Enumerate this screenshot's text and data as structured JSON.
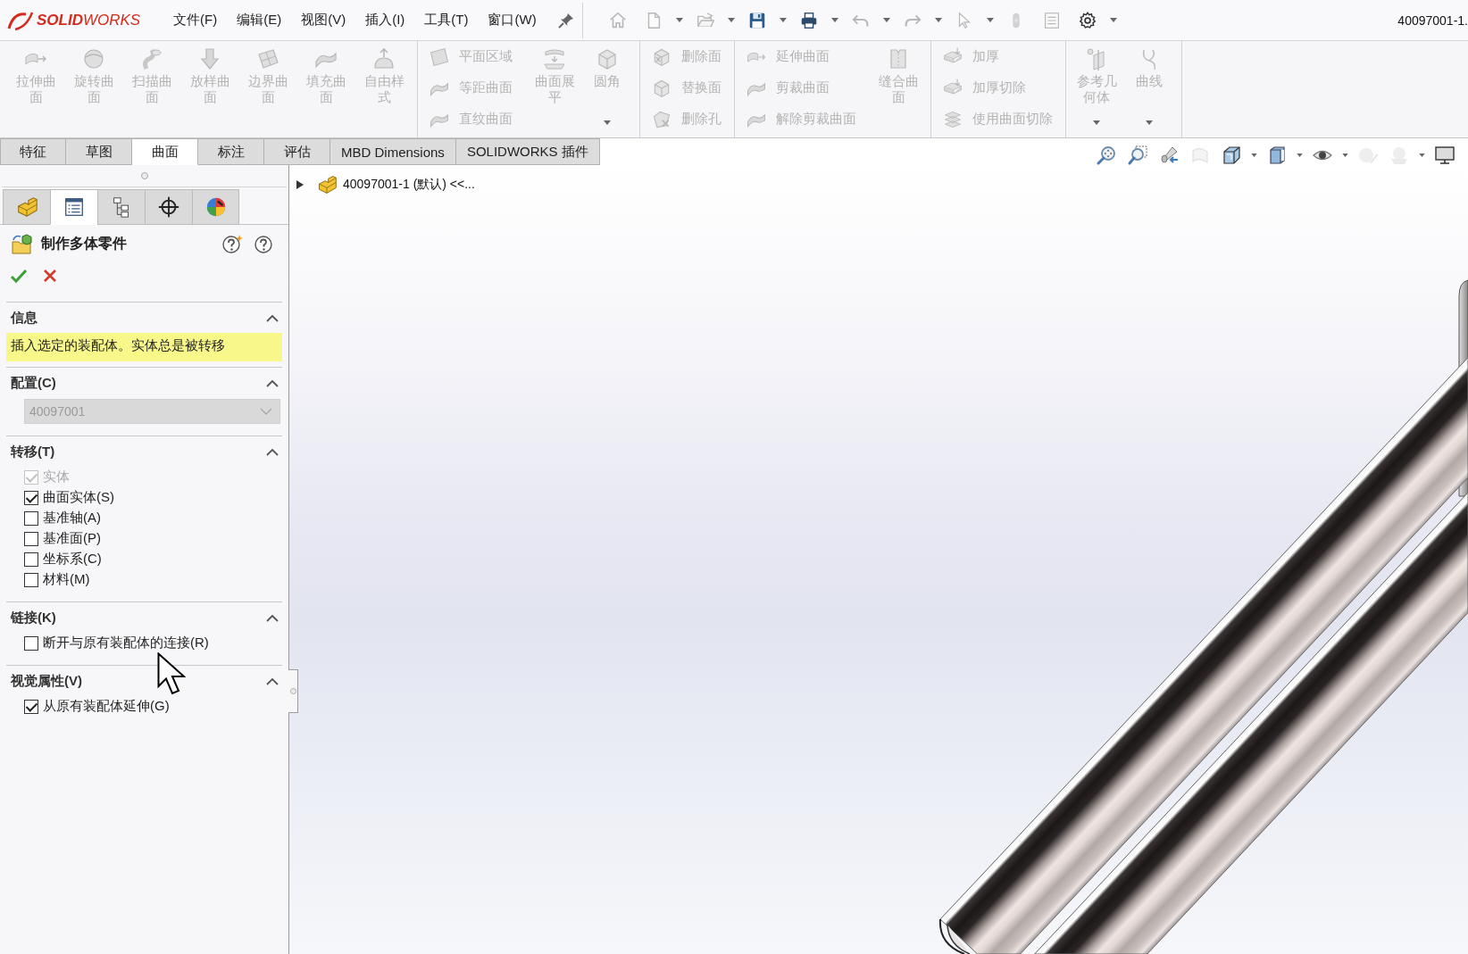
{
  "window": {
    "title": "40097001-1."
  },
  "logo": {
    "text": "**SOLID**WORKS"
  },
  "menu": [
    {
      "label": "文件(F)"
    },
    {
      "label": "编辑(E)"
    },
    {
      "label": "视图(V)"
    },
    {
      "label": "插入(I)"
    },
    {
      "label": "工具(T)"
    },
    {
      "label": "窗口(W)"
    }
  ],
  "quick_access": [
    {
      "disabled": true,
      "dropdown": false
    },
    {
      "disabled": true,
      "dropdown": true
    },
    {
      "disabled": true,
      "dropdown": true
    },
    {
      "disabled": false,
      "dropdown": true
    },
    {
      "disabled": false,
      "dropdown": true
    },
    {
      "disabled": true,
      "dropdown": true
    },
    {
      "disabled": true,
      "dropdown": true
    },
    {
      "disabled": true,
      "dropdown": true
    },
    {
      "disabled": true,
      "dropdown": false
    },
    {
      "disabled": true,
      "dropdown": false
    },
    {
      "disabled": false,
      "dropdown": true
    }
  ],
  "ribbon": {
    "groups": [
      {
        "columns": [
          {
            "kind": "large",
            "label": "拉伸曲面",
            "disabled": true
          },
          {
            "kind": "large",
            "label": "旋转曲面",
            "disabled": true
          },
          {
            "kind": "large",
            "label": "扫描曲面",
            "disabled": true
          },
          {
            "kind": "large",
            "label": "放样曲面",
            "disabled": true
          },
          {
            "kind": "large",
            "label": "边界曲面",
            "disabled": true
          },
          {
            "kind": "large",
            "label": "填充曲面",
            "disabled": true
          },
          {
            "kind": "large",
            "label": "自由样式",
            "disabled": true
          }
        ]
      },
      {
        "columns": [
          {
            "kind": "stack",
            "items": [
              {
                "label": "平面区域",
                "disabled": true
              },
              {
                "label": "等距曲面",
                "disabled": true
              },
              {
                "label": "直纹曲面",
                "disabled": true
              }
            ]
          },
          {
            "kind": "large",
            "label": "曲面展平",
            "disabled": true
          },
          {
            "kind": "large",
            "label": "圆角",
            "disabled": true,
            "dropdown": true
          }
        ]
      },
      {
        "columns": [
          {
            "kind": "stack",
            "items": [
              {
                "label": "删除面",
                "disabled": true
              },
              {
                "label": "替换面",
                "disabled": true
              },
              {
                "label": "删除孔",
                "disabled": true
              }
            ]
          }
        ]
      },
      {
        "columns": [
          {
            "kind": "stack",
            "items": [
              {
                "label": "延伸曲面",
                "disabled": true
              },
              {
                "label": "剪裁曲面",
                "disabled": true
              },
              {
                "label": "解除剪裁曲面",
                "disabled": true
              }
            ]
          },
          {
            "kind": "large",
            "label": "缝合曲面",
            "disabled": true
          }
        ]
      },
      {
        "columns": [
          {
            "kind": "stack",
            "items": [
              {
                "label": "加厚",
                "disabled": true
              },
              {
                "label": "加厚切除",
                "disabled": true
              },
              {
                "label": "使用曲面切除",
                "disabled": true
              }
            ]
          }
        ]
      },
      {
        "columns": [
          {
            "kind": "large",
            "label": "参考几何体",
            "disabled": true,
            "dropdown": true
          },
          {
            "kind": "large",
            "label": "曲线",
            "disabled": true,
            "dropdown": true
          }
        ]
      }
    ]
  },
  "tabs": [
    {
      "label": "特征",
      "selected": false
    },
    {
      "label": "草图",
      "selected": false
    },
    {
      "label": "曲面",
      "selected": true
    },
    {
      "label": "标注",
      "selected": false
    },
    {
      "label": "评估",
      "selected": false
    },
    {
      "label": "MBD Dimensions",
      "selected": false
    },
    {
      "label": "SOLIDWORKS 插件",
      "selected": false
    }
  ],
  "view_toolbar": [
    {
      "disabled": false,
      "dropdown": false
    },
    {
      "disabled": false,
      "dropdown": false
    },
    {
      "disabled": false,
      "dropdown": false
    },
    {
      "disabled": true,
      "dropdown": false
    },
    {
      "disabled": false,
      "dropdown": true
    },
    {
      "disabled": false,
      "dropdown": true
    },
    {
      "disabled": false,
      "dropdown": true
    },
    {
      "disabled": true,
      "dropdown": false
    },
    {
      "disabled": true,
      "dropdown": true
    },
    {
      "disabled": false,
      "dropdown": false
    }
  ],
  "panel_tabs": [
    {
      "selected": false
    },
    {
      "selected": true
    },
    {
      "selected": false
    },
    {
      "selected": false
    },
    {
      "selected": false
    }
  ],
  "property_manager": {
    "title": "制作多体零件",
    "sections": [
      {
        "kind": "message",
        "title": "信息",
        "expanded": true,
        "text": "插入选定的装配体。实体总是被转移"
      },
      {
        "kind": "dropdown",
        "title": "配置(C)",
        "expanded": true,
        "value": "40097001",
        "disabled": true
      },
      {
        "kind": "checkboxes",
        "title": "转移(T)",
        "expanded": true,
        "options": [
          {
            "label": "实体",
            "checked": true,
            "disabled": true
          },
          {
            "label": "曲面实体(S)",
            "checked": true,
            "disabled": false
          },
          {
            "label": "基准轴(A)",
            "checked": false,
            "disabled": false
          },
          {
            "label": "基准面(P)",
            "checked": false,
            "disabled": false
          },
          {
            "label": "坐标系(C)",
            "checked": false,
            "disabled": false
          },
          {
            "label": "材料(M)",
            "checked": false,
            "disabled": false
          }
        ]
      },
      {
        "kind": "checkboxes",
        "title": "链接(K)",
        "expanded": true,
        "options": [
          {
            "label": "断开与原有装配体的连接(R)",
            "checked": false,
            "disabled": false
          }
        ]
      },
      {
        "kind": "checkboxes",
        "title": "视觉属性(V)",
        "expanded": true,
        "options": [
          {
            "label": "从原有装配体延伸(G)",
            "checked": true,
            "disabled": false
          }
        ]
      }
    ]
  },
  "feature_tree": {
    "expanded": false,
    "label": "40097001-1 (默认) <<..."
  }
}
